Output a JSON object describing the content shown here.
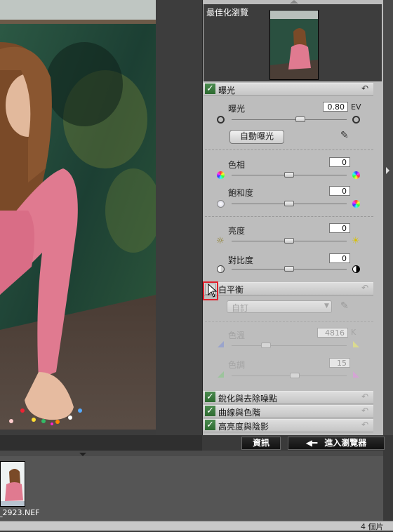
{
  "preview": {
    "title": "最佳化瀏覽"
  },
  "sections": {
    "exposure": {
      "title": "曝光",
      "reset_icon": "reset-arrow-icon",
      "exposure": {
        "label": "曝光",
        "value": "0.80",
        "unit": "EV",
        "level": 0.6
      },
      "auto_button": "自動曝光",
      "hue": {
        "label": "色相",
        "value": "0",
        "level": 0.5
      },
      "saturation": {
        "label": "飽和度",
        "value": "0",
        "level": 0.5
      },
      "brightness": {
        "label": "亮度",
        "value": "0",
        "level": 0.5
      },
      "contrast": {
        "label": "對比度",
        "value": "0",
        "level": 0.5
      }
    },
    "white_balance": {
      "title": "白平衡",
      "preset": "自訂",
      "temperature": {
        "label": "色溫",
        "value": "4816",
        "unit": "K",
        "level": 0.3
      },
      "tint": {
        "label": "色調",
        "value": "15",
        "level": 0.55
      }
    },
    "sharpen": {
      "title": "銳化與去除噪點"
    },
    "curves": {
      "title": "曲線與色階"
    },
    "highlights": {
      "title": "高亮度與陰影"
    }
  },
  "buttons": {
    "info": "資訊",
    "browser": "進入瀏覽器"
  },
  "filmstrip": {
    "file_label": "_2923.NEF"
  },
  "status": {
    "count": "4 個片"
  },
  "colors": {
    "check_green": "#3b7d3f",
    "highlight_red": "#e0202c"
  }
}
